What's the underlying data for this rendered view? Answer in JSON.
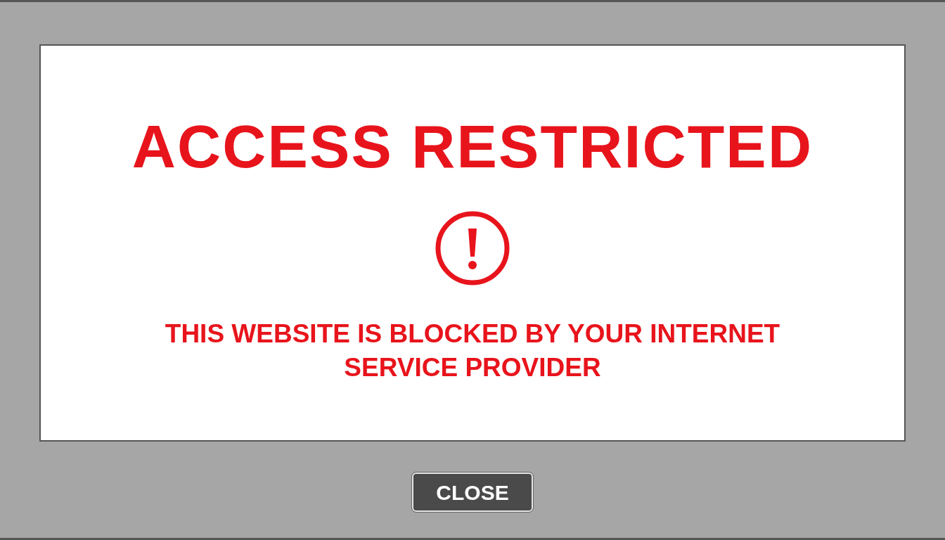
{
  "dialog": {
    "title": "ACCESS RESTRICTED",
    "message": "THIS WEBSITE IS BLOCKED BY YOUR INTERNET SERVICE PROVIDER"
  },
  "buttons": [
    {
      "label": "CLOSE"
    }
  ]
}
